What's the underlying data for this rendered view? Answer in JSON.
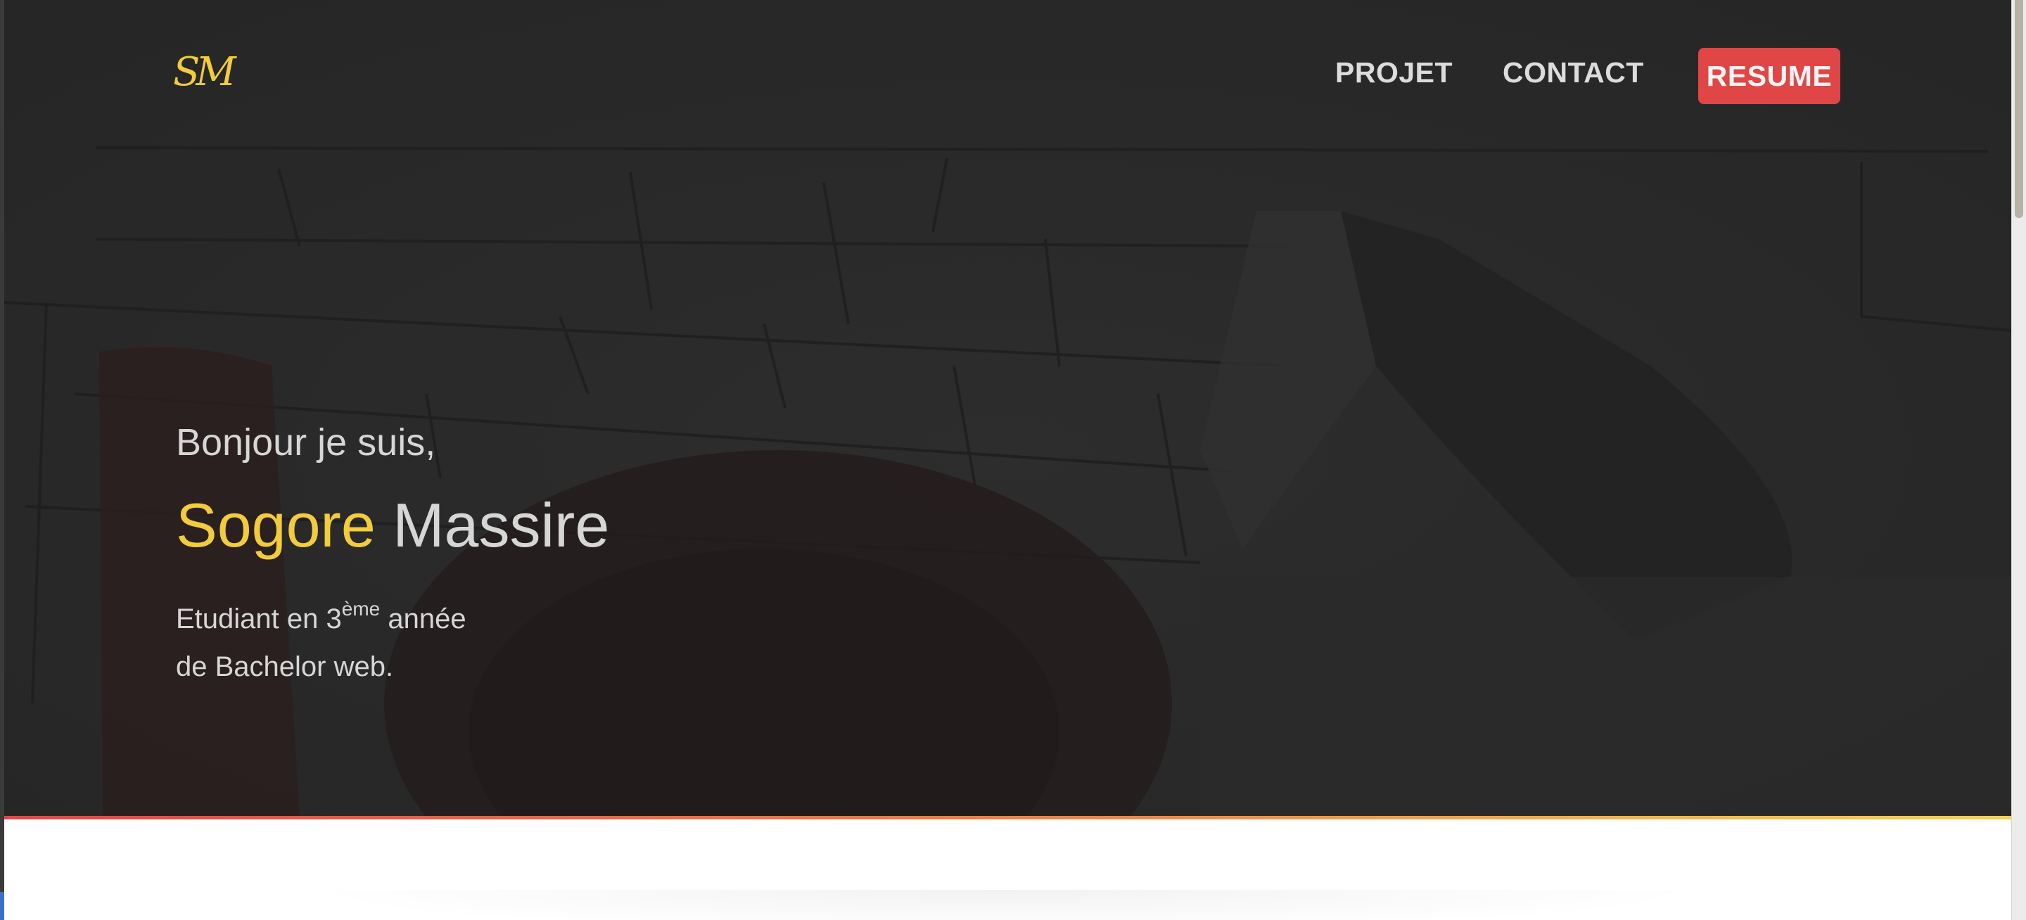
{
  "nav": {
    "logo": "SM",
    "links": [
      {
        "label": "PROJET"
      },
      {
        "label": "CONTACT"
      }
    ],
    "resume_label": "RESUME"
  },
  "hero": {
    "greeting": "Bonjour je suis,",
    "first_name": "Sogore",
    "last_name": "Massire",
    "desc_line1_pre": "Etudiant en 3",
    "desc_sup": "ème",
    "desc_line1_post": " année",
    "desc_line2": "de Bachelor web."
  },
  "colors": {
    "hero_bg": "#282828",
    "accent_yellow": "#f2cc3c",
    "accent_red": "#e04646",
    "text_light": "#d6d6d6"
  }
}
